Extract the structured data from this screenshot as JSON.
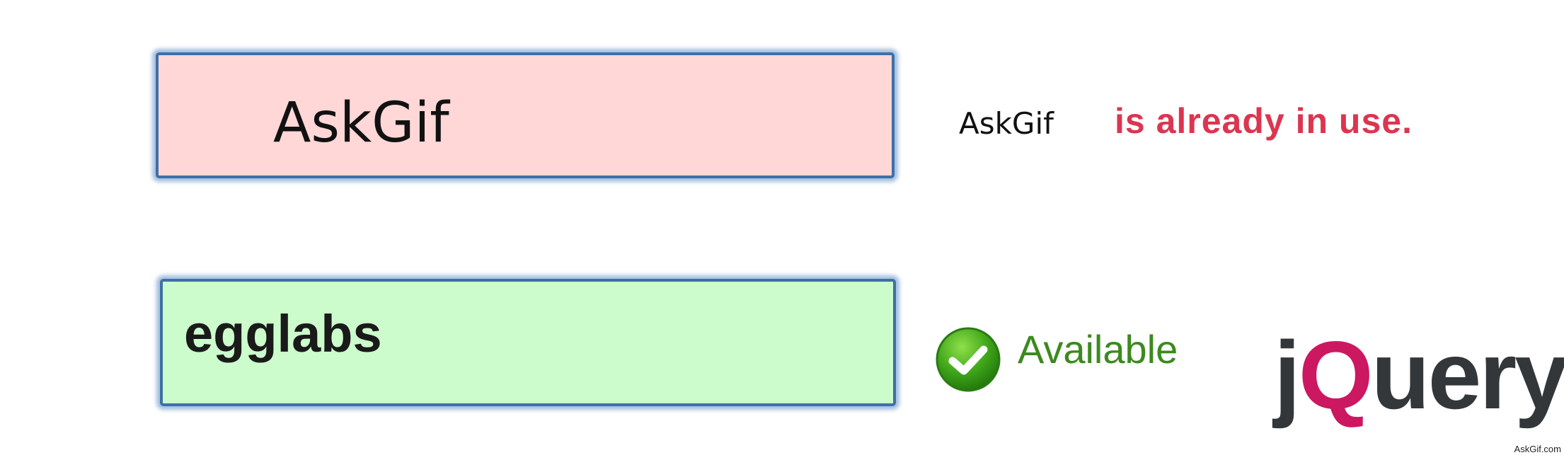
{
  "fields": {
    "taken": {
      "value": "AskGif",
      "background": "#ffd7d7",
      "border_color": "#3f6fa6"
    },
    "available": {
      "value": "egglabs",
      "background": "#ccfccc",
      "border_color": "#3f6fa6"
    }
  },
  "messages": {
    "taken_username": "AskGif",
    "taken_text": "is already in use.",
    "taken_color": "#dc3550",
    "available_text": "Available",
    "available_color": "#3b8a1e",
    "available_icon": "check-circle-icon"
  },
  "logo": {
    "text": "jQuery",
    "prefix": "j",
    "accent": "Q",
    "suffix": "uery",
    "accent_color": "#cb1860",
    "text_color": "#33373a"
  },
  "watermark": "AskGif.com"
}
